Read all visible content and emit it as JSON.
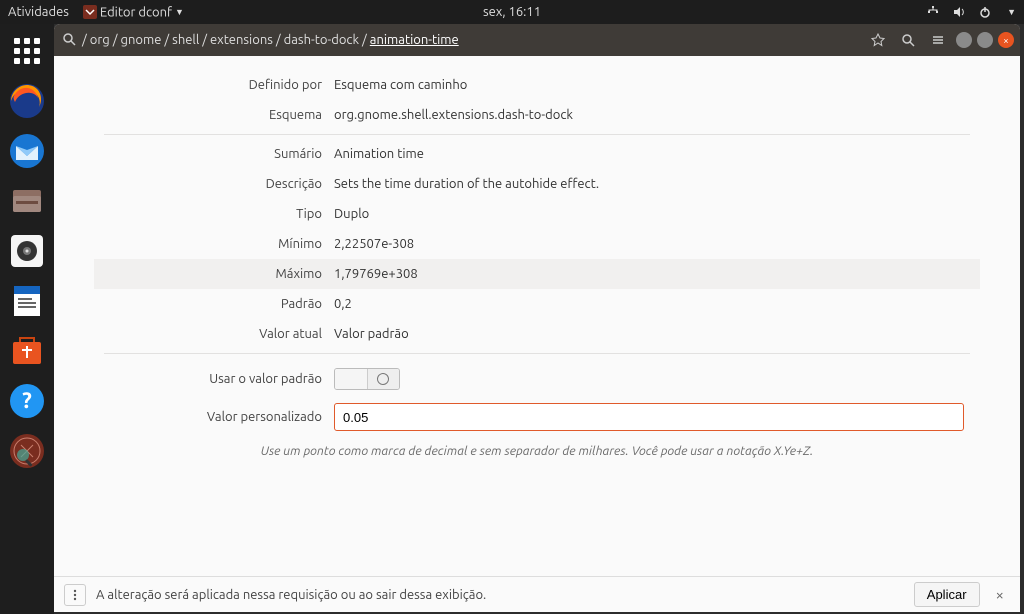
{
  "topbar": {
    "activities": "Atividades",
    "app": "Editor dconf",
    "clock": "sex, 16:11"
  },
  "breadcrumb": {
    "sep": " / ",
    "parts": [
      "",
      "org",
      "gnome",
      "shell",
      "extensions",
      "dash-to-dock"
    ],
    "current": "animation-time"
  },
  "labels": {
    "definido": "Definido por",
    "esquema": "Esquema",
    "sumario": "Sumário",
    "descricao": "Descrição",
    "tipo": "Tipo",
    "minimo": "Mínimo",
    "maximo": "Máximo",
    "padrao": "Padrão",
    "atual": "Valor atual",
    "usar": "Usar o valor padrão",
    "personalizado": "Valor personalizado"
  },
  "vals": {
    "definido": "Esquema com caminho",
    "esquema": "org.gnome.shell.extensions.dash-to-dock",
    "sumario": "Animation time",
    "descricao": "Sets the time duration of the autohide effect.",
    "tipo": "Duplo",
    "minimo": "2,22507e-308",
    "maximo": "1,79769e+308",
    "padrao": "0,2",
    "atual": "Valor padrão",
    "input": "0.05"
  },
  "hint": "Use um ponto como marca de decimal e sem separador de milhares. Você pode usar a notação X.Ye+Z.",
  "infobar": {
    "msg": "A alteração será aplicada nessa requisição ou ao sair dessa exibição.",
    "apply": "Aplicar"
  }
}
